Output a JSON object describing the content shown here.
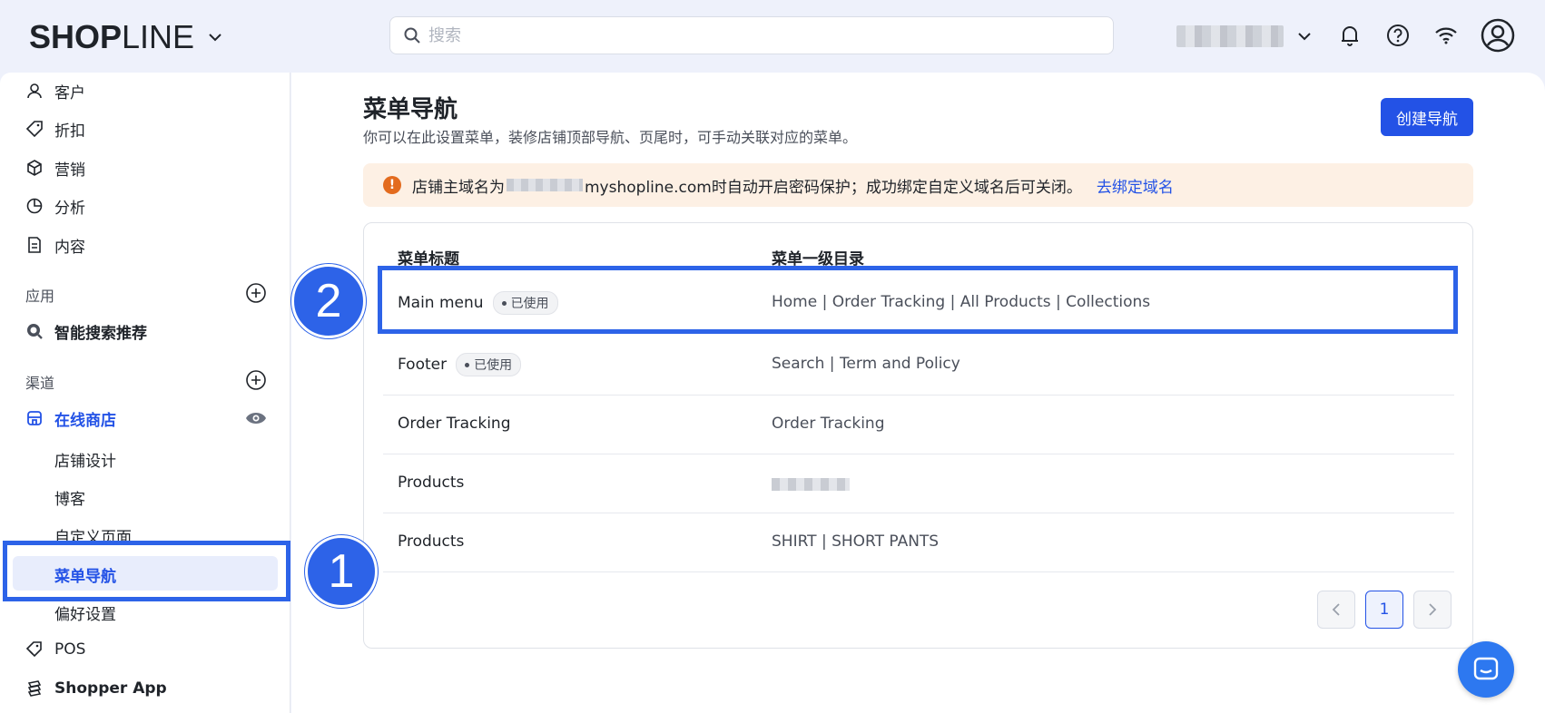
{
  "app": {
    "logo_bold": "SHOP",
    "logo_thin": "LINE"
  },
  "search": {
    "placeholder": "搜索",
    "value": ""
  },
  "sidebar": {
    "items": [
      {
        "label": "客户"
      },
      {
        "label": "折扣"
      },
      {
        "label": "营销"
      },
      {
        "label": "分析"
      },
      {
        "label": "内容"
      }
    ],
    "apps_group": "应用",
    "app_item": "智能搜索推荐",
    "channels_group": "渠道",
    "online_store": "在线商店",
    "store_sub": [
      "店铺设计",
      "博客",
      "自定义页面",
      "菜单导航",
      "偏好设置"
    ],
    "pos": "POS",
    "shopper_app": "Shopper App"
  },
  "annotations": {
    "one": "1",
    "two": "2"
  },
  "page": {
    "title": "菜单导航",
    "subtitle": "你可以在此设置菜单，装修店铺顶部导航、页尾时，可手动关联对应的菜单。",
    "create_button": "创建导航"
  },
  "alert": {
    "icon": "!",
    "text_before": "店铺主域名为",
    "text_after": "myshopline.com时自动开启密码保护；成功绑定自定义域名后可关闭。",
    "link": "去绑定域名"
  },
  "table": {
    "headers": [
      "菜单标题",
      "菜单一级目录"
    ],
    "used_label": "已使用",
    "rows": [
      {
        "title": "Main menu",
        "used": true,
        "menu": "Home | Order Tracking | All Products | Collections"
      },
      {
        "title": "Footer",
        "used": true,
        "menu": "Search | Term and Policy"
      },
      {
        "title": "Order Tracking",
        "used": false,
        "menu": "Order Tracking"
      },
      {
        "title": "Products",
        "used": false,
        "menu": ""
      },
      {
        "title": "Products",
        "used": false,
        "menu": "SHIRT | SHORT PANTS"
      }
    ]
  },
  "pagination": {
    "current": "1"
  },
  "colors": {
    "accent": "#2352e6",
    "annotation": "#2d63e8",
    "alert_bg": "#fdf0e4",
    "warning": "#e36b1e"
  }
}
